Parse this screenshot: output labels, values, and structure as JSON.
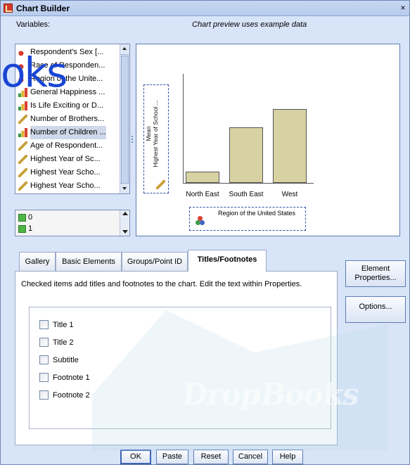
{
  "window": {
    "title": "Chart Builder",
    "close_label": "×"
  },
  "labels": {
    "variables": "Variables:",
    "preview_note": "Chart preview uses example data"
  },
  "variables": [
    {
      "label": "Respondent's Sex [...",
      "icon": "nominal-icon"
    },
    {
      "label": "Race of Responden...",
      "icon": "nominal-icon"
    },
    {
      "label": "Region of the Unite...",
      "icon": "nominal-icon"
    },
    {
      "label": "General Happiness ...",
      "icon": "ordinal-icon"
    },
    {
      "label": "Is Life Exciting or D...",
      "icon": "ordinal-icon"
    },
    {
      "label": "Number of Brothers...",
      "icon": "scale-icon"
    },
    {
      "label": "Number of Children ...",
      "icon": "ordinal-icon"
    },
    {
      "label": "Age of Respondent...",
      "icon": "scale-icon"
    },
    {
      "label": "Highest Year of Sc...",
      "icon": "scale-icon"
    },
    {
      "label": "Highest Year Scho...",
      "icon": "scale-icon"
    },
    {
      "label": "Highest Year Scho...",
      "icon": "scale-icon"
    }
  ],
  "categories": [
    "0",
    "1"
  ],
  "preview": {
    "y_axis_label": "Mean\nHighest Year of School ...",
    "x_axis_label": "Region of the United States"
  },
  "chart_data": {
    "type": "bar",
    "categories": [
      "North East",
      "South East",
      "West"
    ],
    "values": [
      1.1,
      5.6,
      7.4
    ],
    "ylim": [
      0,
      10
    ],
    "xlabel": "Region of the United States",
    "ylabel": "Mean Highest Year of School ..."
  },
  "tabs": [
    {
      "label": "Gallery"
    },
    {
      "label": "Basic Elements"
    },
    {
      "label": "Groups/Point ID"
    },
    {
      "label": "Titles/Footnotes",
      "active": true
    }
  ],
  "panel": {
    "description": "Checked items add titles and footnotes to the chart. Edit the text within Properties.",
    "items": [
      {
        "label": "Title 1",
        "checked": false
      },
      {
        "label": "Title 2",
        "checked": false
      },
      {
        "label": "Subtitle",
        "checked": false
      },
      {
        "label": "Footnote 1",
        "checked": false
      },
      {
        "label": "Footnote 2",
        "checked": false
      }
    ]
  },
  "side_buttons": {
    "element_properties": "Element Properties...",
    "options": "Options..."
  },
  "bottom_buttons": {
    "ok": "OK",
    "paste": "Paste",
    "reset": "Reset",
    "cancel": "Cancel",
    "help": "Help"
  },
  "watermark": {
    "top": "oks",
    "bottom": "DropBooks"
  }
}
